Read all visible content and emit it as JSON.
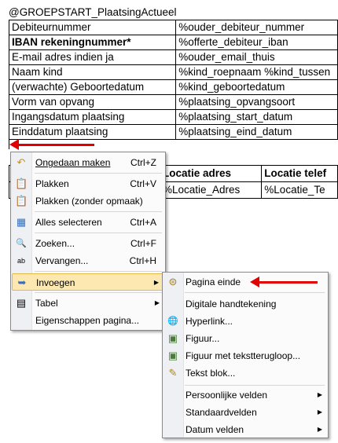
{
  "document": {
    "title": "@GROEPSTART_PlaatsingActueel",
    "table_rows": [
      [
        "Debiteurnummer",
        "%ouder_debiteur_nummer"
      ],
      [
        "IBAN rekeningnummer*",
        " %offerte_debiteur_iban"
      ],
      [
        "E-mail adres indien ja",
        "%ouder_email_thuis"
      ],
      [
        "Naam kind",
        "%kind_roepnaam %kind_tussen"
      ],
      [
        "(verwachte) Geboortedatum",
        "%kind_geboortedatum"
      ],
      [
        "Vorm van opvang",
        "%plaatsing_opvangsoort"
      ],
      [
        "Ingangsdatum plaatsing",
        "%plaatsing_start_datum"
      ],
      [
        "Einddatum plaatsing",
        "%plaatsing_eind_datum"
      ]
    ],
    "second_table": {
      "headers": [
        "",
        "Locatie adres",
        "Locatie telef"
      ],
      "row": [
        "",
        "%Locatie_Adres",
        "%Locatie_Te"
      ]
    }
  },
  "context_menu": {
    "items": [
      {
        "label": "Ongedaan maken",
        "shortcut": "Ctrl+Z",
        "icon": "undo-icon",
        "glyph": "↶"
      },
      {
        "label": "Plakken",
        "shortcut": "Ctrl+V",
        "icon": "paste-icon",
        "glyph": "📋"
      },
      {
        "label": "Plakken (zonder opmaak)",
        "shortcut": "",
        "icon": "paste-plain-icon",
        "glyph": "📋"
      },
      {
        "label": "Alles selecteren",
        "shortcut": "Ctrl+A",
        "icon": "select-all-icon",
        "glyph": "▦"
      },
      {
        "label": "Zoeken...",
        "shortcut": "Ctrl+F",
        "icon": "search-icon",
        "glyph": "🔍"
      },
      {
        "label": "Vervangen...",
        "shortcut": "Ctrl+H",
        "icon": "replace-icon",
        "glyph": "ab"
      },
      {
        "label": "Invoegen",
        "shortcut": "",
        "icon": "insert-icon",
        "glyph": "➥"
      },
      {
        "label": "Tabel",
        "shortcut": "",
        "icon": "table-icon",
        "glyph": "▤"
      },
      {
        "label": "Eigenschappen pagina...",
        "shortcut": "",
        "icon": "",
        "glyph": ""
      }
    ]
  },
  "submenu": {
    "items": [
      {
        "label": "Pagina einde",
        "icon": "page-break-icon",
        "glyph": "⊜"
      },
      {
        "label": "Digitale handtekening",
        "icon": "",
        "glyph": ""
      },
      {
        "label": "Hyperlink...",
        "icon": "hyperlink-icon",
        "glyph": "🌐"
      },
      {
        "label": "Figuur...",
        "icon": "image-icon",
        "glyph": "▣"
      },
      {
        "label": "Figuur met tekstterugloop...",
        "icon": "image-wrap-icon",
        "glyph": "▣"
      },
      {
        "label": "Tekst blok...",
        "icon": "text-block-icon",
        "glyph": "✎"
      },
      {
        "label": "Persoonlijke velden",
        "icon": "",
        "glyph": ""
      },
      {
        "label": "Standaardvelden",
        "icon": "",
        "glyph": ""
      },
      {
        "label": "Datum velden",
        "icon": "",
        "glyph": ""
      }
    ]
  },
  "colors": {
    "highlight": "#fce8b0",
    "arrow": "#e00000",
    "gutter": "#eef0f3"
  }
}
